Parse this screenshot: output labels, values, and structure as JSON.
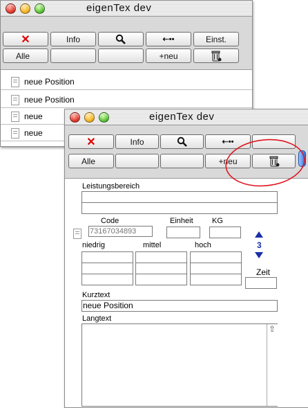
{
  "back_window": {
    "title": "eigenTex dev",
    "toolbar_row1": {
      "delete": "✕",
      "info": "Info",
      "back": "⇠••",
      "settings": "Einst."
    },
    "toolbar_row2": {
      "all": "Alle",
      "new": "+neu"
    },
    "list_items": [
      "neue Position",
      "neue Position",
      "neue",
      "neue"
    ]
  },
  "front_window": {
    "title": "eigenTex dev",
    "toolbar_row1": {
      "delete": "✕",
      "info": "Info",
      "back": "⇠••"
    },
    "toolbar_row2": {
      "all": "Alle",
      "new": "+neu"
    },
    "form": {
      "leistungsbereich_label": "Leistungsbereich",
      "code_label": "Code",
      "code_value": "73167034893",
      "einheit_label": "Einheit",
      "kg_label": "KG",
      "counter": "3",
      "niedrig_label": "niedrig",
      "mittel_label": "mittel",
      "hoch_label": "hoch",
      "zeit_label": "Zeit",
      "kurztext_label": "Kurztext",
      "kurztext_value": "neue Position",
      "langtext_label": "Langtext",
      "scroll_up": "⇧"
    }
  },
  "colors": {
    "highlight_circle": "#e0141e",
    "arrow_blue": "#1b2fa8",
    "delete_red": "#dd0000"
  }
}
